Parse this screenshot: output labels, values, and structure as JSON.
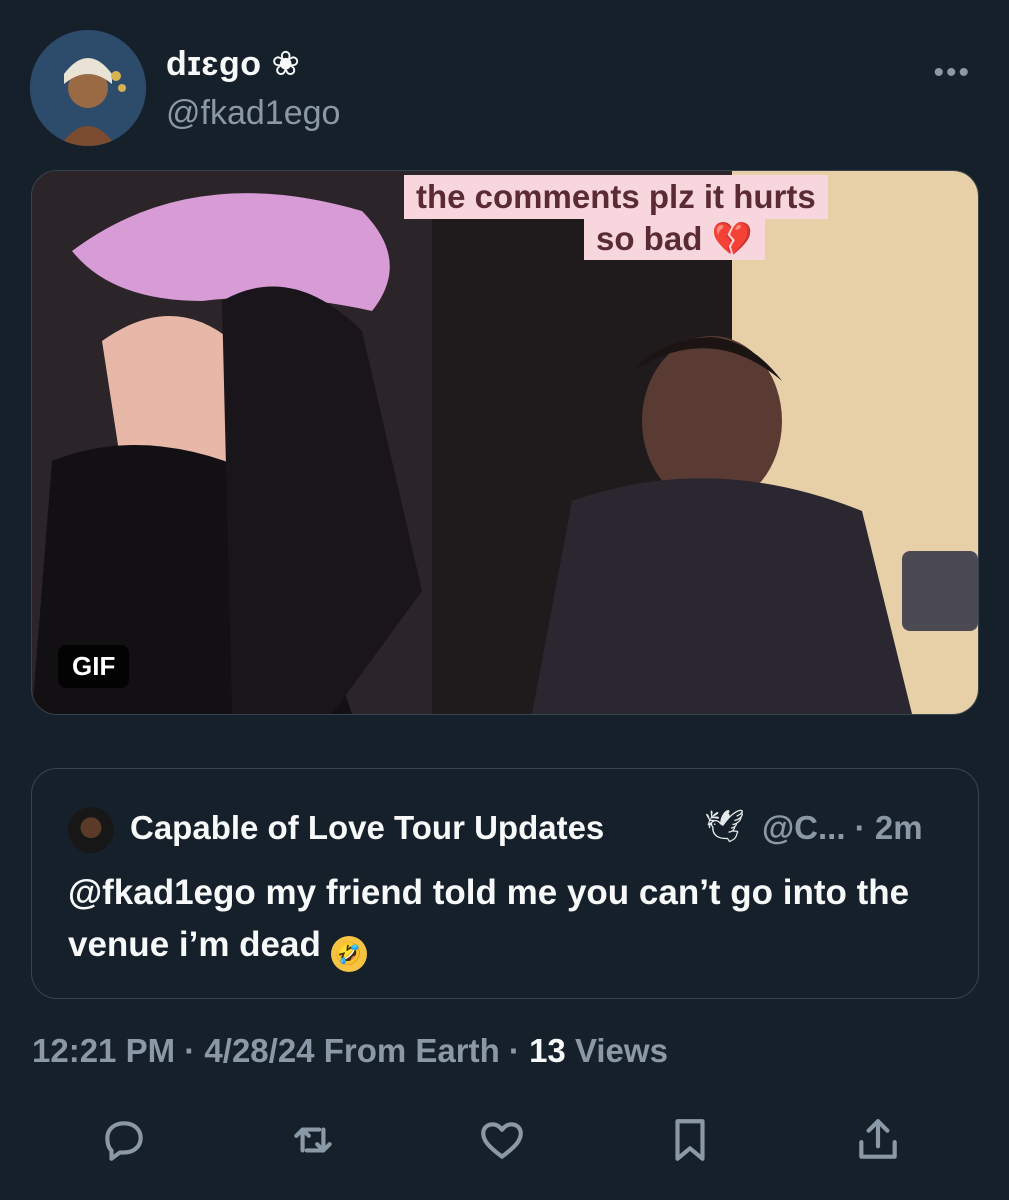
{
  "author": {
    "display_name": "dɪɛgo ❀",
    "handle": "@fkad1ego"
  },
  "menu_icon": "more-icon",
  "media": {
    "caption_line1": "the comments plz it hurts",
    "caption_line2": "so bad 💔",
    "badge": "GIF"
  },
  "quote": {
    "name": "Capable of Love Tour Updates",
    "dove": "🕊",
    "handle_time": "@C... · 2m",
    "text": "@fkad1ego my friend told me you can’t go into the venue i’m dead",
    "emoji": "🤣"
  },
  "meta": {
    "time": "12:21 PM",
    "date": "4/28/24",
    "source": "From Earth",
    "views_count": "13",
    "views_label": "Views"
  },
  "actions": [
    "reply-icon",
    "retweet-icon",
    "like-icon",
    "bookmark-icon",
    "share-icon"
  ],
  "colors": {
    "background": "#15202b",
    "text": "#f7f9f9",
    "muted": "#8b98a5",
    "border": "#38444d"
  }
}
